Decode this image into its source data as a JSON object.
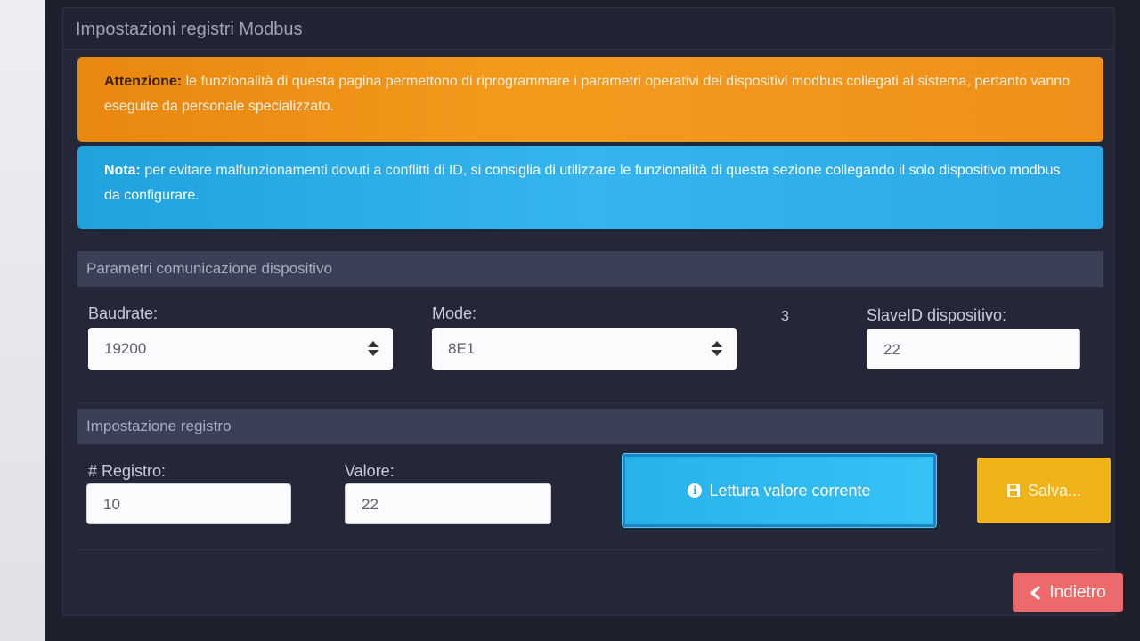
{
  "panel": {
    "title": "Impostazioni registri Modbus"
  },
  "alerts": {
    "warning": {
      "label": "Attenzione:",
      "text": "le funzionalità di questa pagina permettono di riprogrammare i parametri operativi dei dispositivi modbus collegati al sistema, pertanto vanno eseguite da personale specializzato."
    },
    "info": {
      "label": "Nota:",
      "text": "per evitare malfunzionamenti dovuti a conflitti di ID,",
      "strong_text": "si consiglia di utilizzare le funzionalità di questa sezione collegando il solo dispositivo modbus da configurare."
    }
  },
  "communication": {
    "title": "Parametri comunicazione dispositivo",
    "baudrate_label": "Baudrate:",
    "baudrate_value": "19200",
    "mode_label": "Mode:",
    "mode_value": "8E1",
    "extra_value": "3",
    "slaveid_label": "SlaveID dispositivo:",
    "slaveid_value": "22"
  },
  "register": {
    "title": "Impostazione registro",
    "register_label": "# Registro:",
    "register_value": "10",
    "value_label": "Valore:",
    "value_value": "22"
  },
  "buttons": {
    "read_label": "Lettura valore corrente",
    "save_label": "Salva...",
    "back_label": "Indietro"
  },
  "icons": {
    "info": "info-icon",
    "save": "floppy-disk-icon",
    "back": "chevron-left-icon",
    "select_arrows": "sort-arrows-icon"
  },
  "colors": {
    "warning": "#f0901a",
    "info": "#2aa9e6",
    "save": "#f0b418",
    "danger": "#ee6a6a",
    "background": "#242738"
  }
}
